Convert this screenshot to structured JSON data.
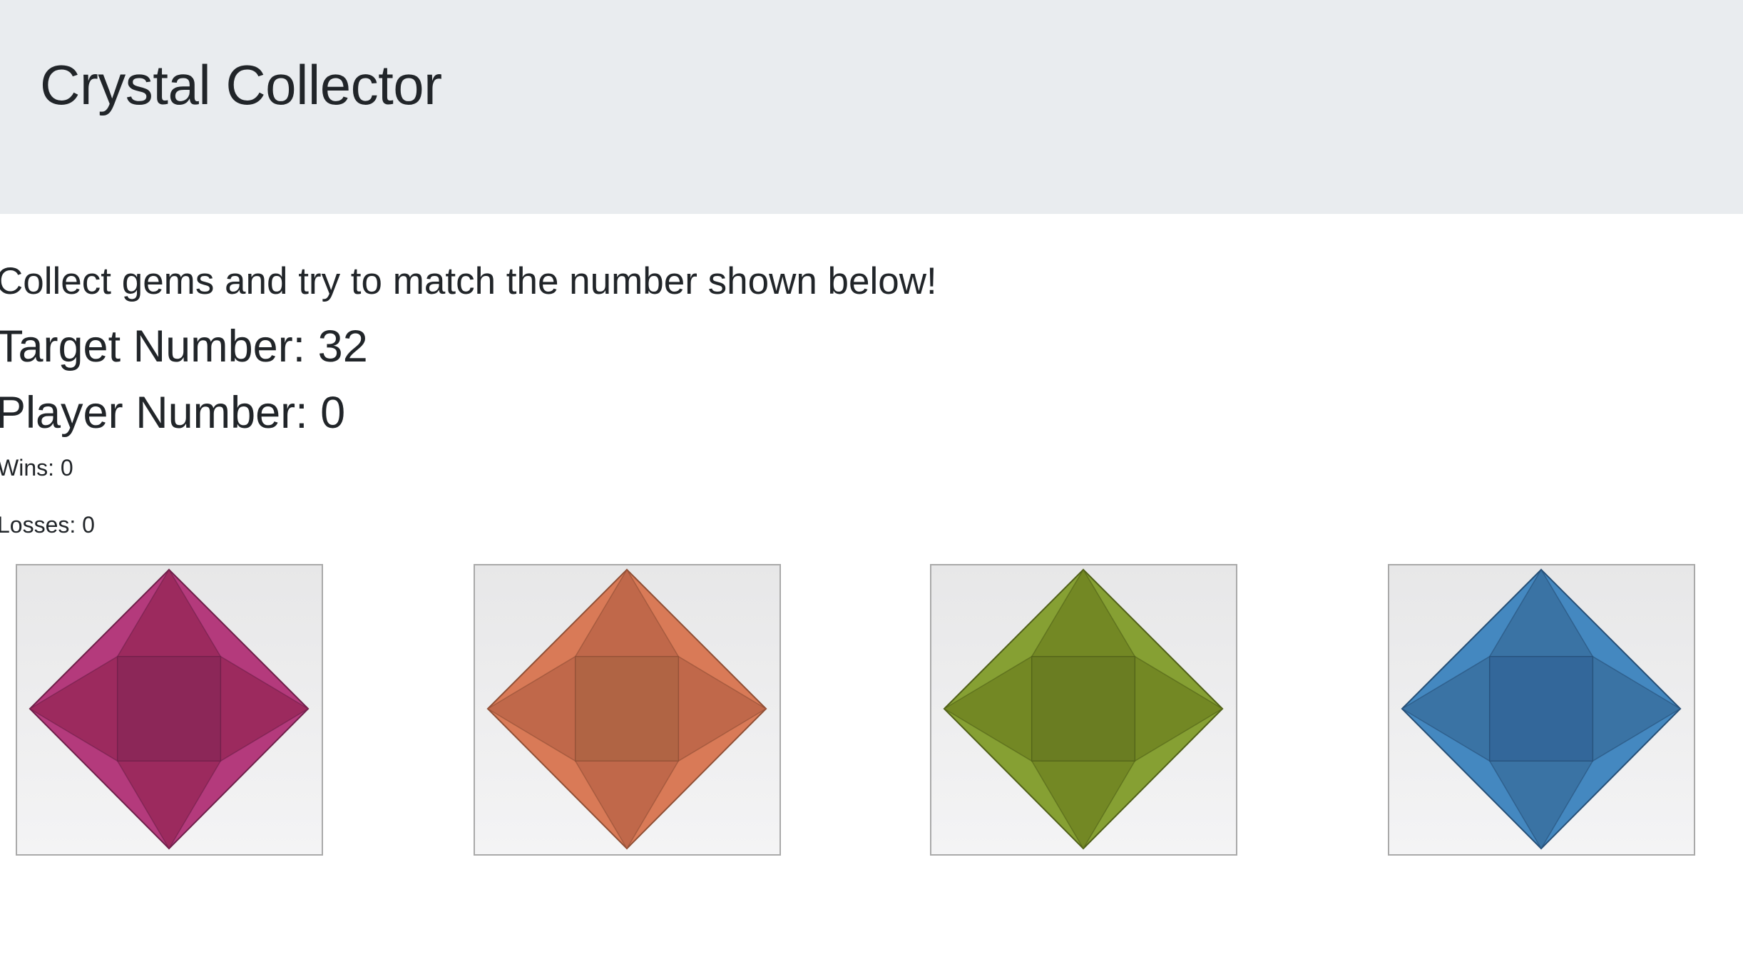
{
  "header": {
    "title": "Crystal Collector"
  },
  "game": {
    "instructions": "Collect gems and try to match the number shown below!",
    "target_label": "Target Number: 32",
    "player_label": "Player Number: 0",
    "wins_label": "Wins: 0",
    "losses_label": "Losses: 0"
  },
  "gems": [
    {
      "name": "magenta-gem",
      "icon": "gem-icon",
      "colors": {
        "outer": "#b43a7c",
        "mid": "#9c2a5e",
        "center": "#8c2758",
        "stroke": "#6e1f49"
      }
    },
    {
      "name": "orange-gem",
      "icon": "gem-icon",
      "colors": {
        "outer": "#d97a57",
        "mid": "#c0684a",
        "center": "#b06444",
        "stroke": "#8f4f35"
      }
    },
    {
      "name": "olive-gem",
      "icon": "gem-icon",
      "colors": {
        "outer": "#86a033",
        "mid": "#738824",
        "center": "#6a7d22",
        "stroke": "#506018"
      }
    },
    {
      "name": "blue-gem",
      "icon": "gem-icon",
      "colors": {
        "outer": "#4488c0",
        "mid": "#3a73a4",
        "center": "#33679a",
        "stroke": "#264f76"
      }
    }
  ]
}
